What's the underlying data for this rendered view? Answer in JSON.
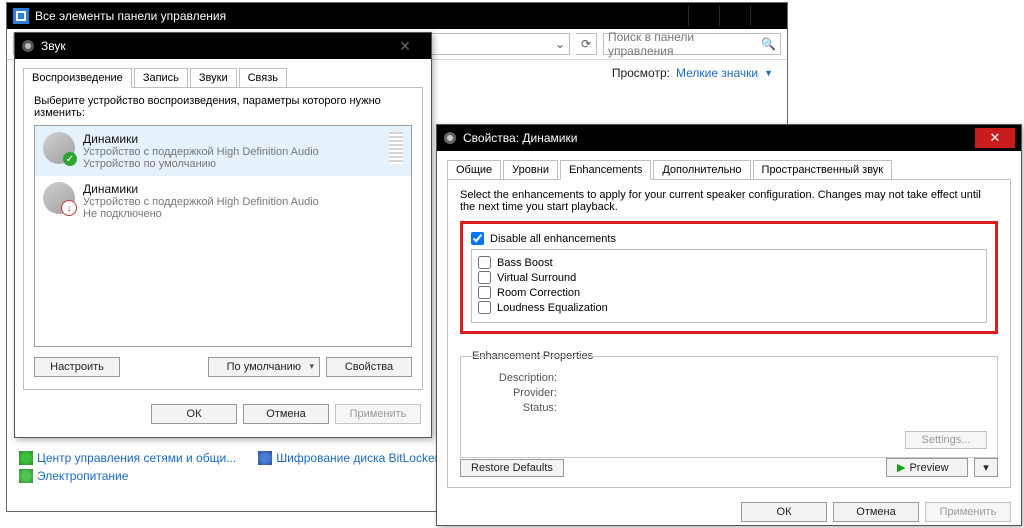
{
  "cp": {
    "title": "Все элементы панели управления",
    "search_placeholder": "Поиск в панели управления",
    "view_label": "Просмотр:",
    "view_value": "Мелкие значки",
    "links": {
      "net": "Центр управления сетями и общи...",
      "bitlocker": "Шифрование диска BitLocker",
      "power": "Электропитание"
    }
  },
  "snd": {
    "title": "Звук",
    "tabs": [
      "Воспроизведение",
      "Запись",
      "Звуки",
      "Связь"
    ],
    "hint": "Выберите устройство воспроизведения, параметры которого нужно изменить:",
    "devices": [
      {
        "name": "Динамики",
        "sub1": "Устройство с поддержкой High Definition Audio",
        "sub2": "Устройство по умолчанию",
        "status": "ok"
      },
      {
        "name": "Динамики",
        "sub1": "Устройство с поддержкой High Definition Audio",
        "sub2": "Не подключено",
        "status": "down"
      }
    ],
    "buttons": {
      "configure": "Настроить",
      "default": "По умолчанию",
      "properties": "Свойства"
    },
    "footer": {
      "ok": "ОК",
      "cancel": "Отмена",
      "apply": "Применить"
    }
  },
  "prop": {
    "title": "Свойства: Динамики",
    "tabs": [
      "Общие",
      "Уровни",
      "Enhancements",
      "Дополнительно",
      "Пространственный звук"
    ],
    "instr": "Select the enhancements to apply for your current speaker configuration. Changes may not take effect until the next time you start playback.",
    "disable_all": "Disable all enhancements",
    "enh": [
      "Bass Boost",
      "Virtual Surround",
      "Room Correction",
      "Loudness Equalization"
    ],
    "group_title": "Enhancement Properties",
    "kv": {
      "desc": "Description:",
      "provider": "Provider:",
      "status": "Status:"
    },
    "settings": "Settings...",
    "restore": "Restore Defaults",
    "preview": "Preview",
    "footer": {
      "ok": "ОК",
      "cancel": "Отмена",
      "apply": "Применить"
    }
  }
}
